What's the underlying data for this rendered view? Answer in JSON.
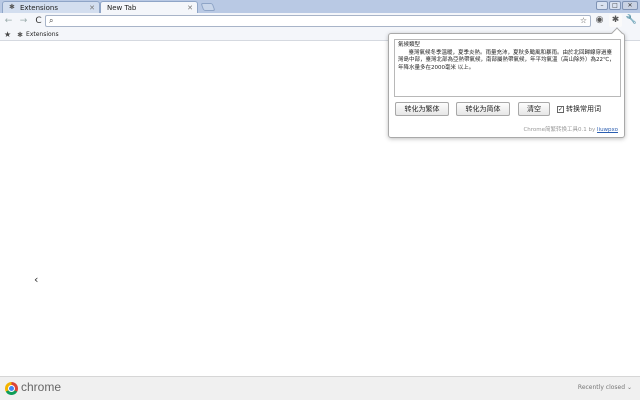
{
  "tabs": [
    {
      "label": "Extensions",
      "icon": "puzzle-icon"
    },
    {
      "label": "New Tab",
      "icon": ""
    }
  ],
  "toolbar": {
    "back_icon": "←",
    "forward_icon": "→",
    "reload_icon": "C",
    "search_icon": "🔍",
    "star_icon": "☆"
  },
  "bookmarks": {
    "items": [
      {
        "label": "Extensions",
        "icon": "puzzle-icon"
      }
    ]
  },
  "popup": {
    "text": "氣候類型\n      臺灣氣候冬季溫暖，夏季炎熱。雨量充沛，夏秋多颱風和暴雨。由於北回歸線穿過臺灣島中部，臺灣北部為亞熱帶氣候，南部屬熱帶氣候，年平均氣溫（高山除外）為22℃，年降水量多在2000毫米 以上。",
    "btn_traditional": "转化为繁体",
    "btn_simplified": "转化为简体",
    "btn_clear": "清空",
    "checkbox_label": "转换常用词",
    "checkbox_checked": true,
    "footer_text": "Chrome简繁转换工具0.1 by ",
    "footer_link": "liuwpxo"
  },
  "bottom": {
    "brand": "chrome",
    "recently_closed": "Recently closed"
  }
}
